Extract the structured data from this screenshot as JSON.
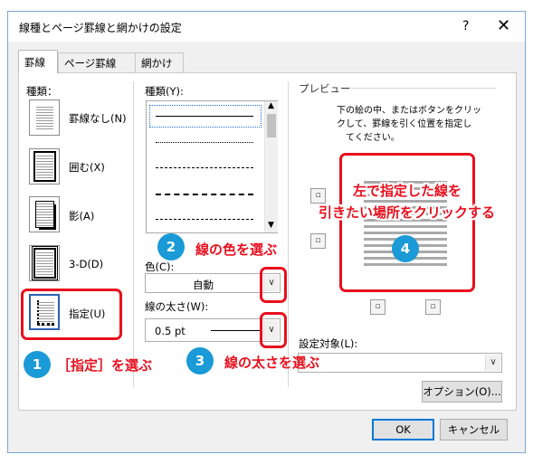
{
  "dialog": {
    "title": "線種とページ罫線と網かけの設定",
    "help": "?",
    "close": "✕"
  },
  "tabs": [
    {
      "label": "罫線",
      "active": true
    },
    {
      "label": "ページ罫線",
      "active": false
    },
    {
      "label": "網かけ",
      "active": false
    }
  ],
  "settings": {
    "header": "種類：",
    "items": [
      {
        "label": "罫線なし(N)",
        "icon": "no-border-icon"
      },
      {
        "label": "囲む(X)",
        "icon": "box-border-icon"
      },
      {
        "label": "影(A)",
        "icon": "shadow-border-icon"
      },
      {
        "label": "3-D(D)",
        "icon": "3d-border-icon"
      },
      {
        "label": "指定(U)",
        "icon": "custom-border-icon",
        "selected": true
      }
    ]
  },
  "style": {
    "header": "種類(Y):",
    "items": [
      "solid",
      "dotted",
      "dashed-small",
      "dashed",
      "dash-dot"
    ],
    "selected": 0
  },
  "color": {
    "label": "色(C):",
    "value": "自動"
  },
  "width": {
    "label": "線の太さ(W):",
    "value": "0.5 pt"
  },
  "preview": {
    "header": "プレビュー",
    "instruction": [
      "下の絵の中、またはボタンをクリッ",
      "クして、罫線を引く位置を指定し",
      "てください。"
    ]
  },
  "apply_to": {
    "label": "設定対象(L):",
    "value": ""
  },
  "buttons": {
    "options": "オプション(O)...",
    "ok": "OK",
    "cancel": "キャンセル"
  },
  "annotations": [
    {
      "number": "1",
      "text": "［指定］を選ぶ"
    },
    {
      "number": "2",
      "text": "線の色を選ぶ"
    },
    {
      "number": "3",
      "text": "線の太さを選ぶ"
    },
    {
      "number": "4",
      "text_lines": [
        "左で指定した線を",
        "引きたい場所をクリックする"
      ]
    }
  ],
  "colors": {
    "highlight_red": "#e8101e",
    "badge_blue": "#1a9ad6",
    "selection_blue": "#0078d7"
  }
}
